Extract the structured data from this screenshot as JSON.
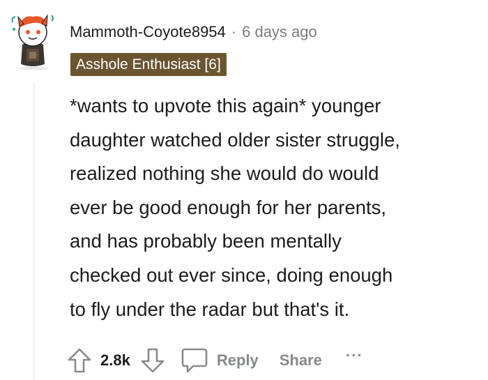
{
  "comment": {
    "username": "Mammoth-Coyote8954",
    "separator": "·",
    "timestamp": "6 days ago",
    "flair": "Asshole Enthusiast [6]",
    "body": "*wants to upvote this again* younger\ndaughter watched older sister struggle,\nrealized nothing she would do would\never be good enough for her parents,\nand has probably been mentally\nchecked out ever since, doing enough\nto fly under the radar but that's it.",
    "score": "2.8k"
  },
  "actions": {
    "upvote_icon": "arrow-up-outline-icon",
    "downvote_icon": "arrow-down-outline-icon",
    "reply_icon": "speech-bubble-icon",
    "reply_label": "Reply",
    "share_label": "Share",
    "more_label": "···"
  },
  "colors": {
    "flair_bg": "#6a5530",
    "meta_gray": "#7c7c7c",
    "action_gray": "#878a8c",
    "thread_line": "#edeff1"
  }
}
